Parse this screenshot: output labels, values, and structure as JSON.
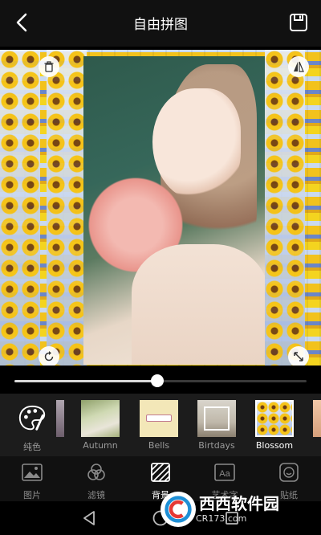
{
  "header": {
    "title": "自由拼图"
  },
  "slider": {
    "value_fraction": 0.49
  },
  "backgrounds": {
    "items": [
      {
        "label": "纯色",
        "active": false
      },
      {
        "label": "Autumn",
        "active": false
      },
      {
        "label": "Bells",
        "active": false
      },
      {
        "label": "Birtdays",
        "active": false
      },
      {
        "label": "Blossom",
        "active": true
      }
    ]
  },
  "nav": {
    "items": [
      {
        "label": "图片",
        "icon": "image-icon",
        "active": false
      },
      {
        "label": "滤镜",
        "icon": "filter-icon",
        "active": false
      },
      {
        "label": "背景",
        "icon": "background-icon",
        "active": true
      },
      {
        "label": "艺术字",
        "icon": "text-art-icon",
        "active": false
      },
      {
        "label": "贴纸",
        "icon": "sticker-icon",
        "active": false
      }
    ]
  },
  "watermark": {
    "brand": "西西软件园",
    "url": "CR173.com"
  },
  "colors": {
    "accent": "#ffffff",
    "nav_bg": "#111111",
    "list_bg": "#1c1c1c"
  }
}
